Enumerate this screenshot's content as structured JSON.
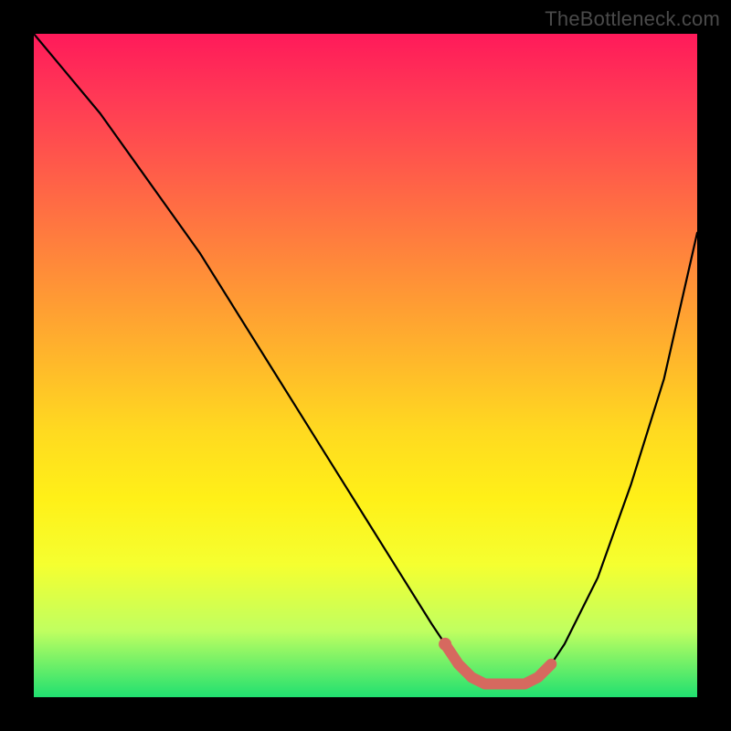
{
  "attribution": "TheBottleneck.com",
  "chart_data": {
    "type": "line",
    "title": "",
    "xlabel": "",
    "ylabel": "",
    "xlim": [
      0,
      100
    ],
    "ylim": [
      0,
      100
    ],
    "series": [
      {
        "name": "bottleneck-curve",
        "x": [
          0,
          5,
          10,
          15,
          20,
          25,
          30,
          35,
          40,
          45,
          50,
          55,
          60,
          62,
          64,
          66,
          68,
          70,
          72,
          74,
          76,
          78,
          80,
          85,
          90,
          95,
          100
        ],
        "y": [
          100,
          94,
          88,
          81,
          74,
          67,
          59,
          51,
          43,
          35,
          27,
          19,
          11,
          8,
          5,
          3,
          2,
          2,
          2,
          2,
          3,
          5,
          8,
          18,
          32,
          48,
          70
        ]
      }
    ],
    "highlight_segment": {
      "name": "optimal-zone",
      "x": [
        62,
        64,
        66,
        68,
        70,
        72,
        74,
        76,
        78
      ],
      "y": [
        8,
        5,
        3,
        2,
        2,
        2,
        2,
        3,
        5
      ]
    }
  },
  "colors": {
    "curve": "#000000",
    "highlight": "#d6695f"
  }
}
